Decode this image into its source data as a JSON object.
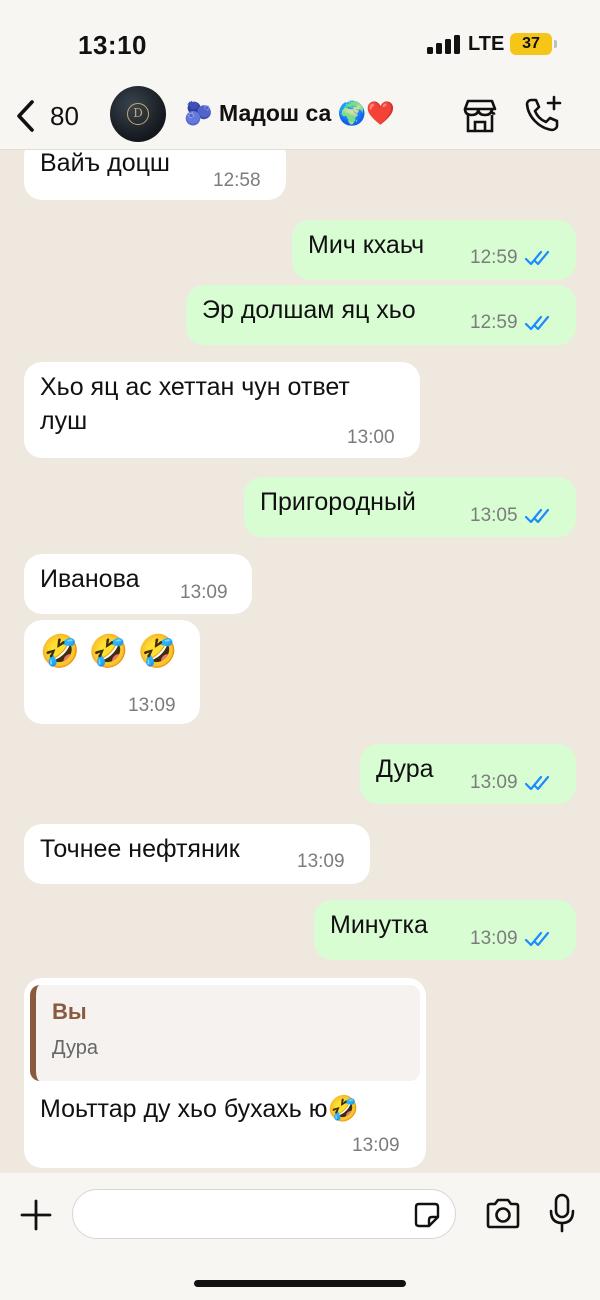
{
  "status_bar": {
    "time": "13:10",
    "network": "LTE",
    "battery": "37"
  },
  "header": {
    "back_count": "80",
    "title": "🫐 Мадош са 🌍❤️",
    "avatar_icon": "avatar-logo",
    "actions": [
      "store-icon",
      "call-add-icon"
    ]
  },
  "messages": [
    {
      "dir": "in",
      "text": "Вайъ доцш",
      "time": "12:58"
    },
    {
      "dir": "out",
      "text": "Мич кхаьч",
      "time": "12:59",
      "read": true
    },
    {
      "dir": "out",
      "text": "Эр долшам яц хьо",
      "time": "12:59",
      "read": true
    },
    {
      "dir": "in",
      "text": "Хьо яц ас хеттан чун ответ луш",
      "time": "13:00"
    },
    {
      "dir": "out",
      "text": "Пригородный",
      "time": "13:05",
      "read": true
    },
    {
      "dir": "in",
      "text": "Иванова",
      "time": "13:09"
    },
    {
      "dir": "in",
      "text": "🤣 🤣 🤣",
      "time": "13:09"
    },
    {
      "dir": "out",
      "text": "Дура",
      "time": "13:09",
      "read": true
    },
    {
      "dir": "in",
      "text": "Точнее нефтяник",
      "time": "13:09"
    },
    {
      "dir": "out",
      "text": "Минутка",
      "time": "13:09",
      "read": true
    },
    {
      "dir": "in",
      "text": "Моьттар ду хьо бухахь ю🤣",
      "time": "13:09",
      "reply": {
        "name": "Вы",
        "text": "Дура"
      }
    }
  ],
  "input": {
    "placeholder": "",
    "value": ""
  },
  "colors": {
    "incoming": "#ffffff",
    "outgoing": "#d9fdd3",
    "read_ticks": "#1a8cff",
    "background": "#efe8de",
    "reply_accent": "#8a5a3e"
  }
}
